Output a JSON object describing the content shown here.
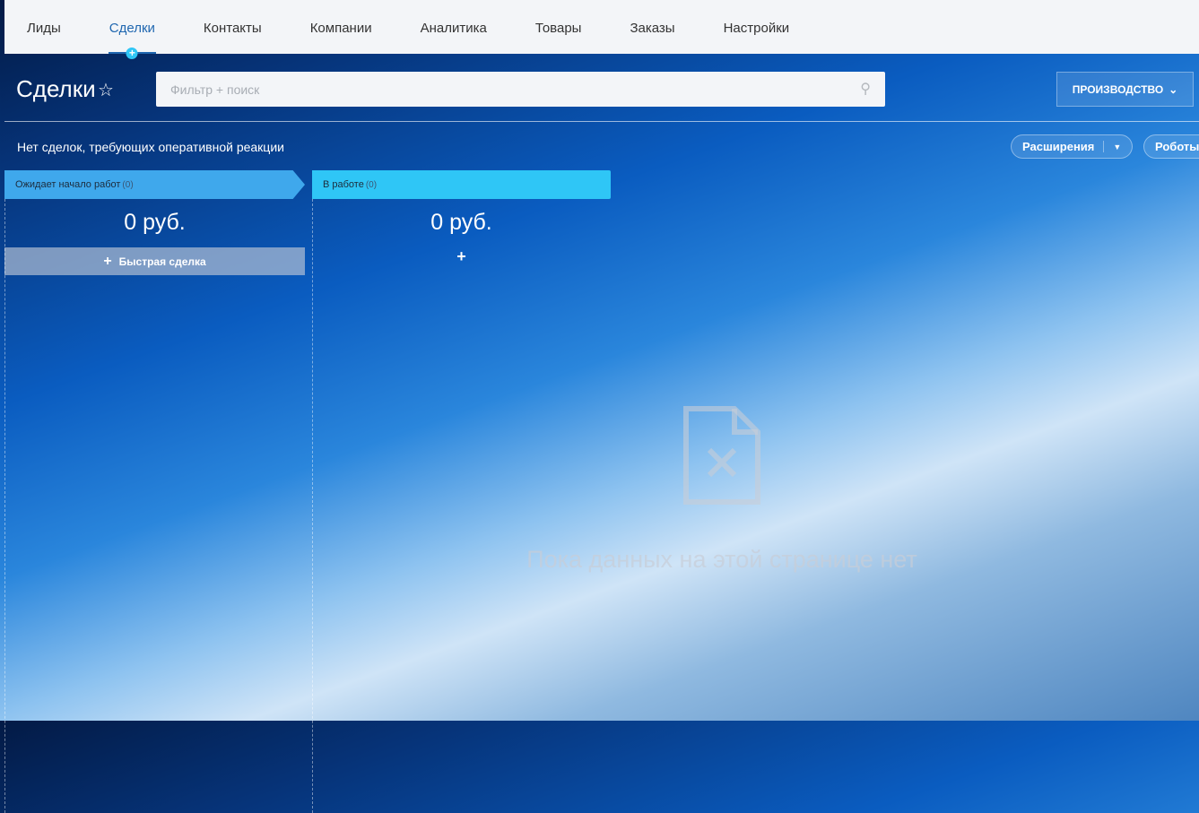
{
  "nav": {
    "items": [
      "Лиды",
      "Сделки",
      "Контакты",
      "Компании",
      "Аналитика",
      "Товары",
      "Заказы",
      "Настройки"
    ],
    "active": 1
  },
  "header": {
    "title": "Сделки",
    "search_placeholder": "Фильтр + поиск",
    "category_button": "ПРОИЗВОДСТВО"
  },
  "toolbar": {
    "notice": "Нет сделок, требующих оперативной реакции",
    "extensions": "Расширения",
    "robots": "Роботы"
  },
  "columns": [
    {
      "title": "Ожидает начало работ",
      "count": "(0)",
      "sum": "0 руб.",
      "quick_label": "Быстрая сделка",
      "color": "#3fa8ec"
    },
    {
      "title": "В работе",
      "count": "(0)",
      "sum": "0 руб.",
      "color": "#2fc6f6"
    }
  ],
  "empty": {
    "message": "Пока данных на этой странице нет"
  }
}
